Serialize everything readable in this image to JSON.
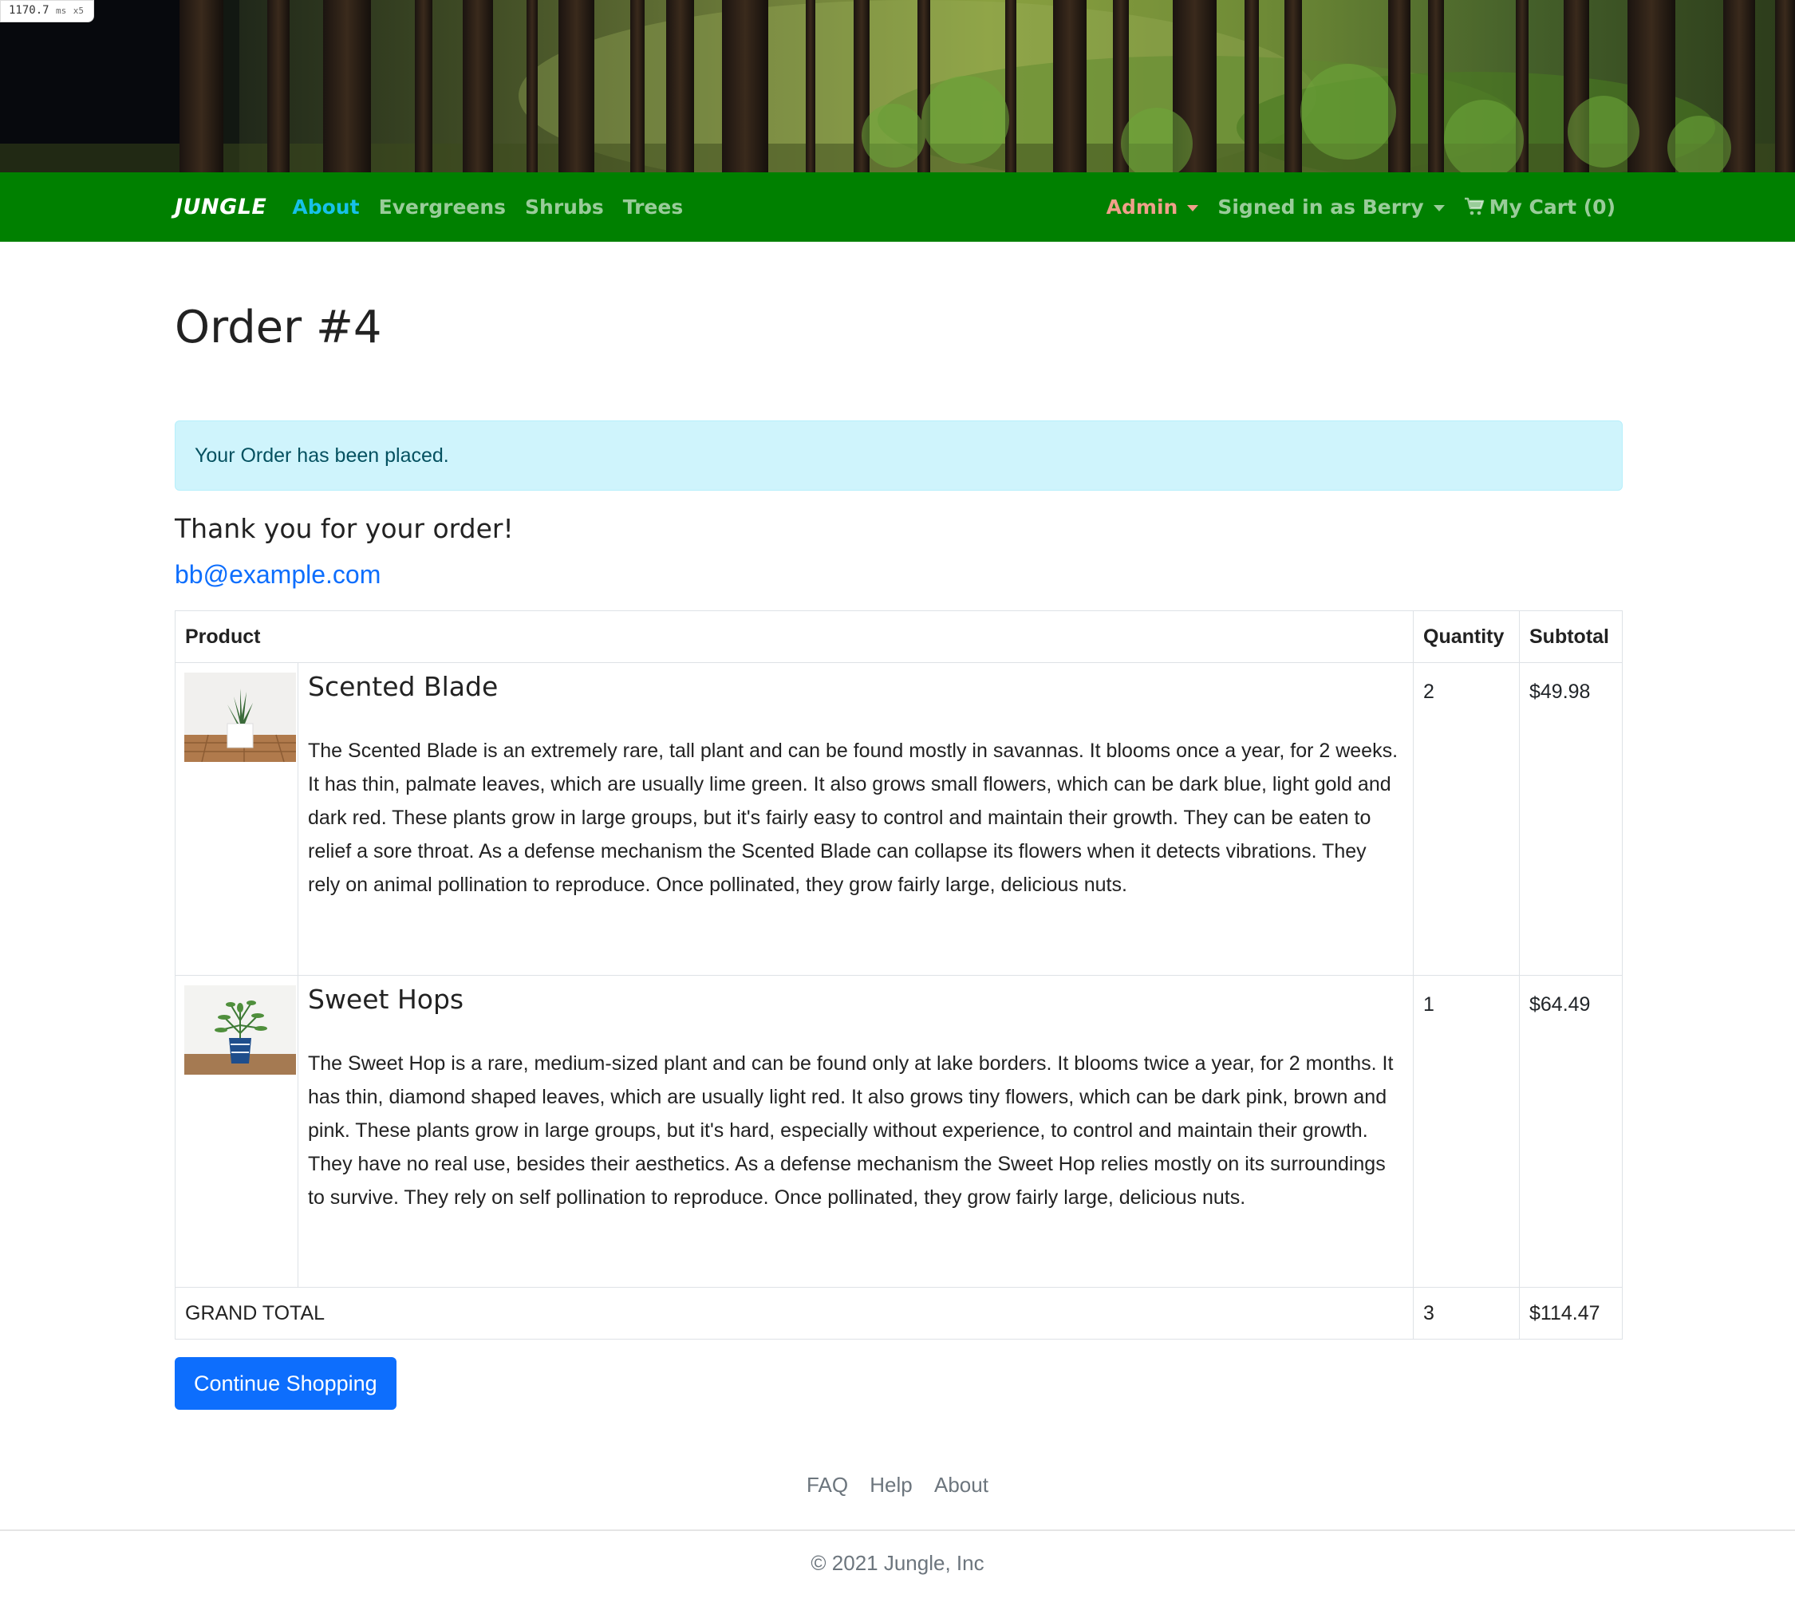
{
  "perf": {
    "value": "1170.7",
    "unit": "ms",
    "mult": "x5"
  },
  "nav": {
    "brand": "JUNGLE",
    "links": [
      "About",
      "Evergreens",
      "Shrubs",
      "Trees"
    ],
    "admin": "Admin",
    "user": "Signed in as Berry",
    "cart": "My Cart (0)"
  },
  "colors": {
    "navbar": "#008000",
    "active_link": "#17c1e8",
    "admin_link": "#f0a08a",
    "alert_bg": "#cff4fc",
    "primary": "#0d6efd"
  },
  "order": {
    "title": "Order #4",
    "alert": "Your Order has been placed.",
    "thanks": "Thank you for your order!",
    "email": "bb@example.com",
    "columns": {
      "product": "Product",
      "quantity": "Quantity",
      "subtotal": "Subtotal"
    },
    "items": [
      {
        "name": "Scented Blade",
        "description": "The Scented Blade is an extremely rare, tall plant and can be found mostly in savannas. It blooms once a year, for 2 weeks. It has thin, palmate leaves, which are usually lime green. It also grows small flowers, which can be dark blue, light gold and dark red. These plants grow in large groups, but it's fairly easy to control and maintain their growth. They can be eaten to relief a sore throat. As a defense mechanism the Scented Blade can collapse its flowers when it detects vibrations. They rely on animal pollination to reproduce. Once pollinated, they grow fairly large, delicious nuts.",
        "quantity": "2",
        "subtotal": "$49.98"
      },
      {
        "name": "Sweet Hops",
        "description": "The Sweet Hop is a rare, medium-sized plant and can be found only at lake borders. It blooms twice a year, for 2 months. It has thin, diamond shaped leaves, which are usually light red. It also grows tiny flowers, which can be dark pink, brown and pink. These plants grow in large groups, but it's hard, especially without experience, to control and maintain their growth. They have no real use, besides their aesthetics. As a defense mechanism the Sweet Hop relies mostly on its surroundings to survive. They rely on self pollination to reproduce. Once pollinated, they grow fairly large, delicious nuts.",
        "quantity": "1",
        "subtotal": "$64.49"
      }
    ],
    "grand_total_label": "GRAND TOTAL",
    "grand_total_quantity": "3",
    "grand_total": "$114.47",
    "continue_button": "Continue Shopping"
  },
  "footer": {
    "links": [
      "FAQ",
      "Help",
      "About"
    ],
    "copyright": "© 2021 Jungle, Inc"
  }
}
